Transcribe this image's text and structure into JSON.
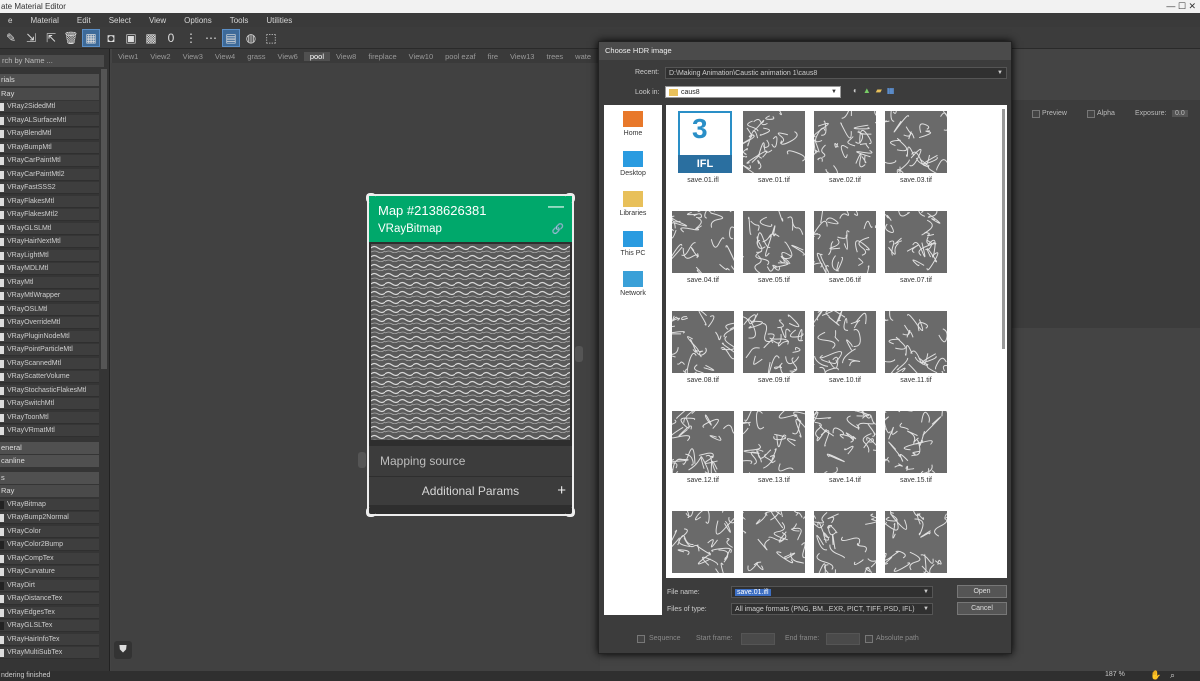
{
  "window": {
    "title": "ate Material Editor",
    "controls": "— ☐ ✕"
  },
  "menu": [
    "e",
    "Material",
    "Edit",
    "Select",
    "View",
    "Options",
    "Tools",
    "Utilities"
  ],
  "toolbar_icons": [
    "pick-material-icon",
    "put-to-scene-icon",
    "assign-icon",
    "delete-icon",
    "layout-icon",
    "show-map-icon",
    "background-icon",
    "checker-icon",
    "material-id-icon",
    "move-children-icon",
    "layout-children-icon",
    "layout-all-icon",
    "show-end-result-icon",
    "navigator-icon"
  ],
  "view_tabs": [
    "View1",
    "View2",
    "View3",
    "View4",
    "grass",
    "View6",
    "pool",
    "View8",
    "fireplace",
    "View10",
    "pool ezaf",
    "fire",
    "View13",
    "trees",
    "wate"
  ],
  "active_view_tab": "pool",
  "left_panel": {
    "search_placeholder": "rch by Name ...",
    "section_materials": "rials",
    "subsection_vray": "Ray",
    "materials": [
      "VRay2SidedMtl",
      "VRayALSurfaceMtl",
      "VRayBlendMtl",
      "VRayBumpMtl",
      "VRayCarPaintMtl",
      "VRayCarPaintMtl2",
      "VRayFastSSS2",
      "VRayFlakesMtl",
      "VRayFlakesMtl2",
      "VRayGLSLMtl",
      "VRayHairNextMtl",
      "VRayLightMtl",
      "VRayMDLMtl",
      "VRayMtl",
      "VRayMtlWrapper",
      "VRayOSLMtl",
      "VRayOverrideMtl",
      "VRayPluginNodeMtl",
      "VRayPointParticleMtl",
      "VRayScannedMtl",
      "VRayScatterVolume",
      "VRayStochasticFlakesMtl",
      "VRaySwitchMtl",
      "VRayToonMtl",
      "VRayVRmatMtl"
    ],
    "section_general": "eneral",
    "section_scanline": "canline",
    "section_maps": "s",
    "subsection_maps_vray": "Ray",
    "maps": [
      "VRayBitmap",
      "VRayBump2Normal",
      "VRayColor",
      "VRayColor2Bump",
      "VRayCompTex",
      "VRayCurvature",
      "VRayDirt",
      "VRayDistanceTex",
      "VRayEdgesTex",
      "VRayGLSLTex",
      "VRayHairInfoTex",
      "VRayMultiSubTex"
    ]
  },
  "node": {
    "title": "Map #2138626381",
    "subtitle": "VRayBitmap",
    "minimize": "—",
    "mapping_source": "Mapping source",
    "additional_params": "Additional Params",
    "plus": "+"
  },
  "right_panel": {
    "preview_label": "Preview",
    "alpha_label": "Alpha",
    "exposure_label": "Exposure:",
    "exposure_value": "0.0"
  },
  "dialog": {
    "title": "Choose HDR image",
    "recent_label": "Recent:",
    "recent_value": "D:\\Making Animation\\Caustic animation 1\\caus8",
    "lookin_label": "Look in:",
    "lookin_value": "caus8",
    "places": [
      {
        "label": "Home",
        "icon": "home-icon"
      },
      {
        "label": "Desktop",
        "icon": "desktop-icon"
      },
      {
        "label": "Libraries",
        "icon": "libraries-icon"
      },
      {
        "label": "This PC",
        "icon": "this-pc-icon"
      },
      {
        "label": "Network",
        "icon": "network-icon"
      }
    ],
    "ifl_badge_number": "3",
    "ifl_badge_text": "IFL",
    "files": [
      "save.01.ifl",
      "save.01.tif",
      "save.02.tif",
      "save.03.tif",
      "save.04.tif",
      "save.05.tif",
      "save.06.tif",
      "save.07.tif",
      "save.08.tif",
      "save.09.tif",
      "save.10.tif",
      "save.11.tif",
      "save.12.tif",
      "save.13.tif",
      "save.14.tif",
      "save.15.tif",
      "",
      "",
      "",
      ""
    ],
    "filename_label": "File name:",
    "filename_value": "save.01.ifl",
    "filetype_label": "Files of type:",
    "filetype_value": "All image formats (PNG, BM...EXR, PICT, TIFF, PSD, IFL)",
    "open_label": "Open",
    "cancel_label": "Cancel",
    "sequence_label": "Sequence",
    "start_frame_label": "Start frame:",
    "end_frame_label": "End frame:",
    "absolute_path_label": "Absolute path"
  },
  "status": {
    "text": "ndering finished",
    "zoom": "187 %"
  },
  "colors": {
    "node_header": "#00a86b",
    "selection": "#3d6a99",
    "dialog_bg": "#3c3c3c"
  }
}
